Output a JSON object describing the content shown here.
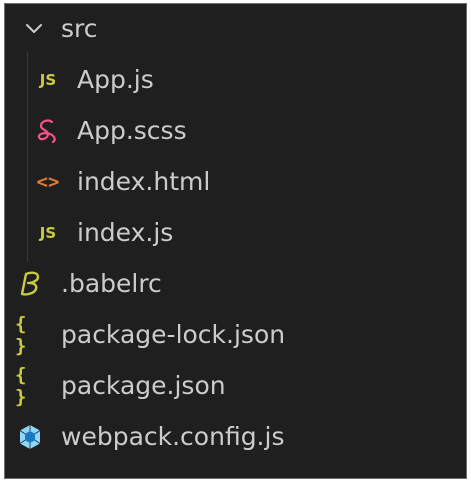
{
  "explorer": {
    "folder": {
      "label": "src",
      "expanded": true,
      "chevron_icon": "chevron-down-icon",
      "files": [
        {
          "label": "App.js",
          "icon": "js-icon",
          "icon_text": "JS",
          "icon_color": "#cbcb41"
        },
        {
          "label": "App.scss",
          "icon": "sass-icon",
          "icon_color": "#f55385"
        },
        {
          "label": "index.html",
          "icon": "html-icon",
          "icon_text": "<>",
          "icon_color": "#e37933"
        },
        {
          "label": "index.js",
          "icon": "js-icon",
          "icon_text": "JS",
          "icon_color": "#cbcb41"
        }
      ]
    },
    "root_files": [
      {
        "label": ".babelrc",
        "icon": "babel-icon",
        "icon_color": "#cbcb41"
      },
      {
        "label": "package-lock.json",
        "icon": "json-icon",
        "icon_text": "{ }",
        "icon_color": "#cbcb41"
      },
      {
        "label": "package.json",
        "icon": "json-icon",
        "icon_text": "{ }",
        "icon_color": "#cbcb41"
      },
      {
        "label": "webpack.config.js",
        "icon": "webpack-icon",
        "icon_color": "#519aba"
      }
    ]
  }
}
